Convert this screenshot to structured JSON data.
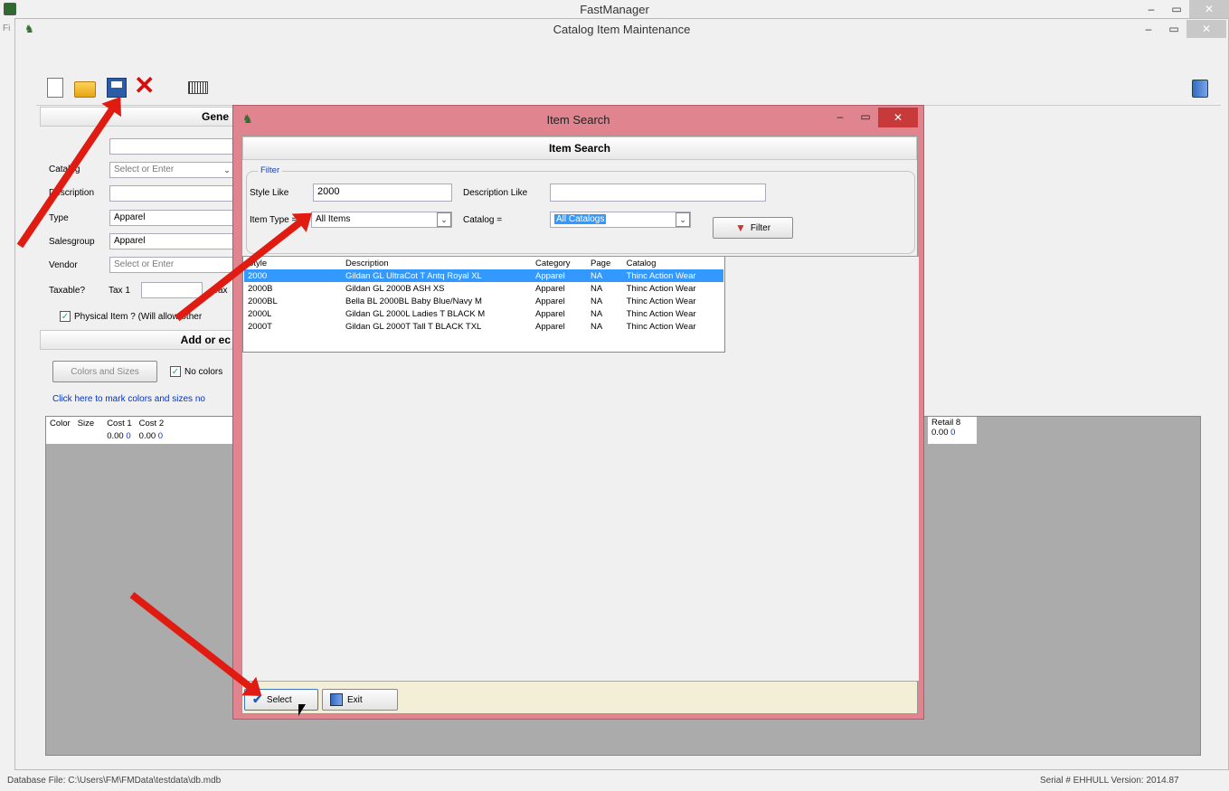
{
  "app": {
    "title": "FastManager",
    "menu_stub": "Fi"
  },
  "child": {
    "title": "Catalog Item Maintenance"
  },
  "main": {
    "section_general": "Gene",
    "section_add": "Add or ec",
    "fields": {
      "catalog_label": "Catalog",
      "catalog_placeholder": "Select or Enter",
      "description_label": "Description",
      "type_label": "Type",
      "type_value": "Apparel",
      "salesgroup_label": "Salesgroup",
      "salesgroup_value": "Apparel",
      "vendor_label": "Vendor",
      "vendor_placeholder": "Select or Enter",
      "taxable_label": "Taxable?",
      "tax1_label": "Tax 1",
      "tax2_stub": "Tax",
      "physical_label": "Physical Item ? (Will allow other"
    },
    "colors_sizes_button": "Colors and Sizes",
    "no_colors_label": "No colors",
    "click_here_link": "Click here to mark colors and sizes no",
    "grid": {
      "headers": [
        "Color",
        "Size",
        "Cost 1",
        "Cost 2"
      ],
      "row": [
        "",
        "",
        "0.00",
        "0",
        "0.00",
        "0"
      ],
      "retail_header": "Retail 8",
      "retail_value": "0.00",
      "retail_count": "0"
    }
  },
  "dialog": {
    "title": "Item Search",
    "header": "Item Search",
    "filter_group": "Filter",
    "style_like_label": "Style Like",
    "style_like_value": "2000",
    "description_like_label": "Description Like",
    "description_like_value": "",
    "item_type_label": "Item Type =",
    "item_type_value": "All Items",
    "catalog_label": "Catalog =",
    "catalog_value": "All Catalogs",
    "filter_button": "Filter",
    "results": {
      "headers": [
        "Style",
        "Description",
        "Category",
        "Page",
        "Catalog"
      ],
      "rows": [
        [
          "2000",
          "Gildan GL UltraCot T Antq Royal XL",
          "Apparel",
          "NA",
          "Thinc Action Wear"
        ],
        [
          "2000B",
          "Gildan GL 2000B ASH XS",
          "Apparel",
          "NA",
          "Thinc Action Wear"
        ],
        [
          "2000BL",
          "Bella BL 2000BL Baby Blue/Navy M",
          "Apparel",
          "NA",
          "Thinc Action Wear"
        ],
        [
          "2000L",
          "Gildan GL 2000L Ladies T BLACK M",
          "Apparel",
          "NA",
          "Thinc Action Wear"
        ],
        [
          "2000T",
          "Gildan GL 2000T Tall T BLACK TXL",
          "Apparel",
          "NA",
          "Thinc Action Wear"
        ]
      ],
      "selected_index": 0
    },
    "select_button": "Select",
    "exit_button": "Exit"
  },
  "status": {
    "database": "Database File: C:\\Users\\FM\\FMData\\testdata\\db.mdb",
    "serial": "Serial # EHHULL   Version: 2014.87"
  },
  "colors": {
    "accent": "#e0848f",
    "selection": "#3399ff",
    "arrow": "#e01c12"
  }
}
